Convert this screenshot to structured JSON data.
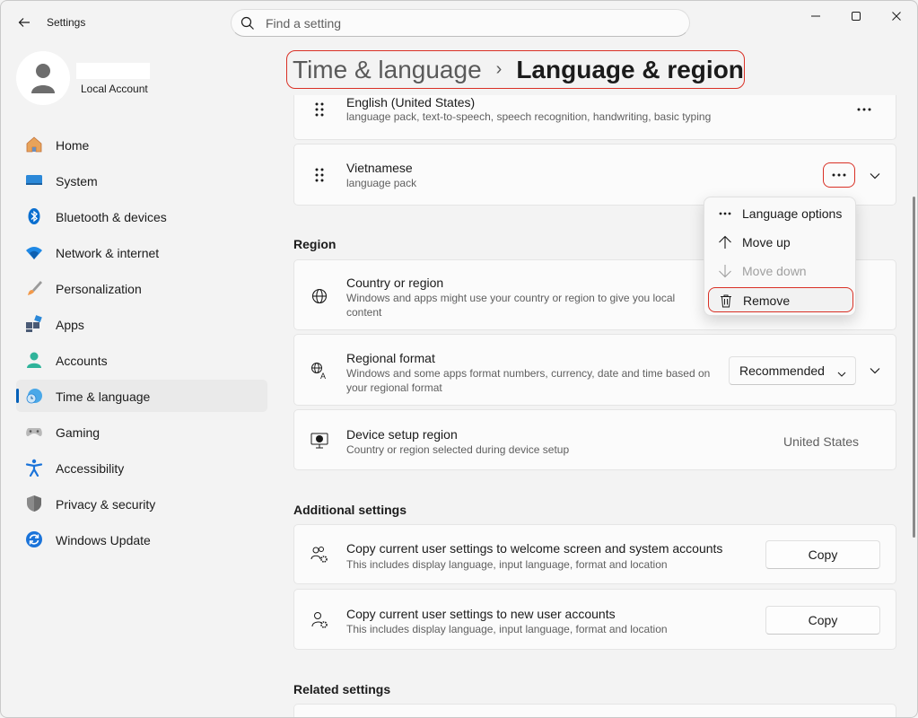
{
  "window": {
    "app_title": "Settings"
  },
  "search": {
    "placeholder": "Find a setting"
  },
  "profile": {
    "account_type": "Local Account"
  },
  "sidebar": {
    "items": [
      {
        "label": "Home",
        "icon": "home-icon"
      },
      {
        "label": "System",
        "icon": "system-icon"
      },
      {
        "label": "Bluetooth & devices",
        "icon": "bluetooth-icon"
      },
      {
        "label": "Network & internet",
        "icon": "wifi-icon"
      },
      {
        "label": "Personalization",
        "icon": "brush-icon"
      },
      {
        "label": "Apps",
        "icon": "apps-icon"
      },
      {
        "label": "Accounts",
        "icon": "accounts-icon"
      },
      {
        "label": "Time & language",
        "icon": "time-language-icon",
        "active": true
      },
      {
        "label": "Gaming",
        "icon": "gamepad-icon"
      },
      {
        "label": "Accessibility",
        "icon": "accessibility-icon"
      },
      {
        "label": "Privacy & security",
        "icon": "shield-icon"
      },
      {
        "label": "Windows Update",
        "icon": "update-icon"
      }
    ]
  },
  "breadcrumb": {
    "parent": "Time & language",
    "separator": "›",
    "current": "Language & region"
  },
  "languages": [
    {
      "name": "English (United States)",
      "features": "language pack, text-to-speech, speech recognition, handwriting, basic typing"
    },
    {
      "name": "Vietnamese",
      "features": "language pack"
    }
  ],
  "context_menu": {
    "items": [
      {
        "label": "Language options",
        "icon": "more-icon",
        "disabled": false
      },
      {
        "label": "Move up",
        "icon": "arrow-up-icon",
        "disabled": false
      },
      {
        "label": "Move down",
        "icon": "arrow-down-icon",
        "disabled": true
      },
      {
        "label": "Remove",
        "icon": "trash-icon",
        "disabled": false
      }
    ]
  },
  "region": {
    "section_title": "Region",
    "country": {
      "title": "Country or region",
      "desc": "Windows and apps might use your country or region to give you local content"
    },
    "format": {
      "title": "Regional format",
      "desc": "Windows and some apps format numbers, currency, date and time based on your regional format",
      "value": "Recommended"
    },
    "device_setup": {
      "title": "Device setup region",
      "desc": "Country or region selected during device setup",
      "value": "United States"
    }
  },
  "additional": {
    "section_title": "Additional settings",
    "copy_welcome": {
      "title": "Copy current user settings to welcome screen and system accounts",
      "desc": "This includes display language, input language, format and location",
      "button": "Copy"
    },
    "copy_new_users": {
      "title": "Copy current user settings to new user accounts",
      "desc": "This includes display language, input language, format and location",
      "button": "Copy"
    }
  },
  "related": {
    "section_title": "Related settings"
  },
  "colors": {
    "accent": "#005fb8",
    "highlight_outline": "#d93025"
  }
}
